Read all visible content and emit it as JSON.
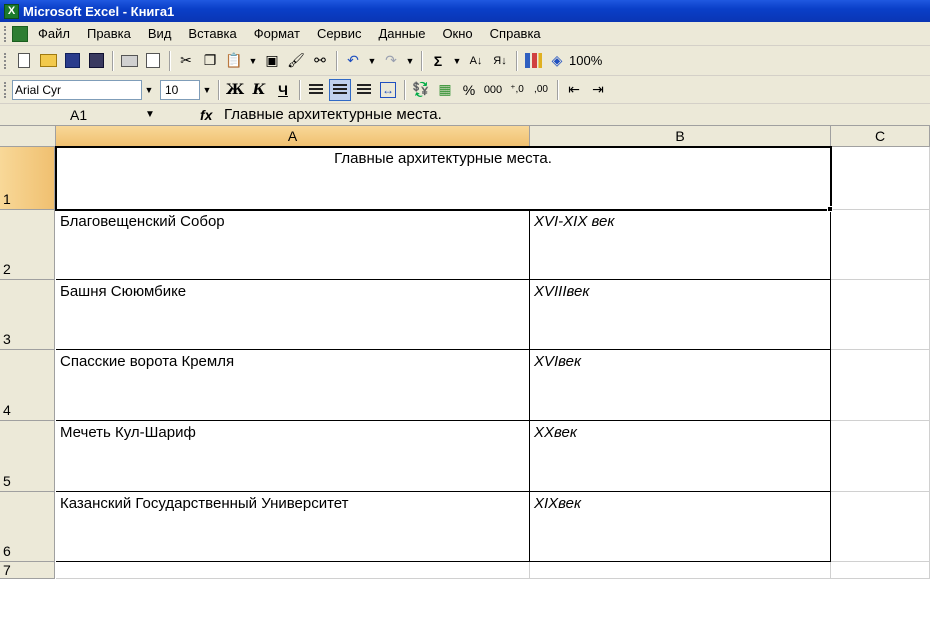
{
  "window": {
    "title": "Microsoft Excel - Книга1",
    "app_icon": "excel-icon"
  },
  "menu": {
    "items": [
      {
        "label": "Файл"
      },
      {
        "label": "Правка"
      },
      {
        "label": "Вид"
      },
      {
        "label": "Вставка"
      },
      {
        "label": "Формат"
      },
      {
        "label": "Сервис"
      },
      {
        "label": "Данные"
      },
      {
        "label": "Окно"
      },
      {
        "label": "Справка"
      }
    ]
  },
  "toolbar": {
    "sum_symbol": "Σ",
    "zoom": "100%"
  },
  "format_toolbar": {
    "font": "Arial Cyr",
    "size": "10",
    "bold": "Ж",
    "italic": "К",
    "underline": "Ч",
    "percent": "%",
    "thousands": "000",
    "inc_decimal": "⁺,0",
    "dec_decimal": ",00"
  },
  "formula_bar": {
    "name_box": "A1",
    "fx_label": "fx",
    "value": "Главные архитектурные места."
  },
  "sheet": {
    "columns": [
      "A",
      "B",
      "C"
    ],
    "selected_column": "A",
    "rows": [
      {
        "num": "1",
        "a": "Главные архитектурные места.",
        "b": ""
      },
      {
        "num": "2",
        "a": "Благовещенский Собор",
        "b": "XVI-XIX век"
      },
      {
        "num": "3",
        "a": "Башня Сююмбике",
        "b": "XVIIIвек"
      },
      {
        "num": "4",
        "a": "Спасские ворота Кремля",
        "b": "XVIвек"
      },
      {
        "num": "5",
        "a": "Мечеть Кул-Шариф",
        "b": "XXвек"
      },
      {
        "num": "6",
        "a": "Казанский Государственный Университет",
        "b": "XIXвек"
      },
      {
        "num": "7",
        "a": "",
        "b": ""
      }
    ]
  }
}
